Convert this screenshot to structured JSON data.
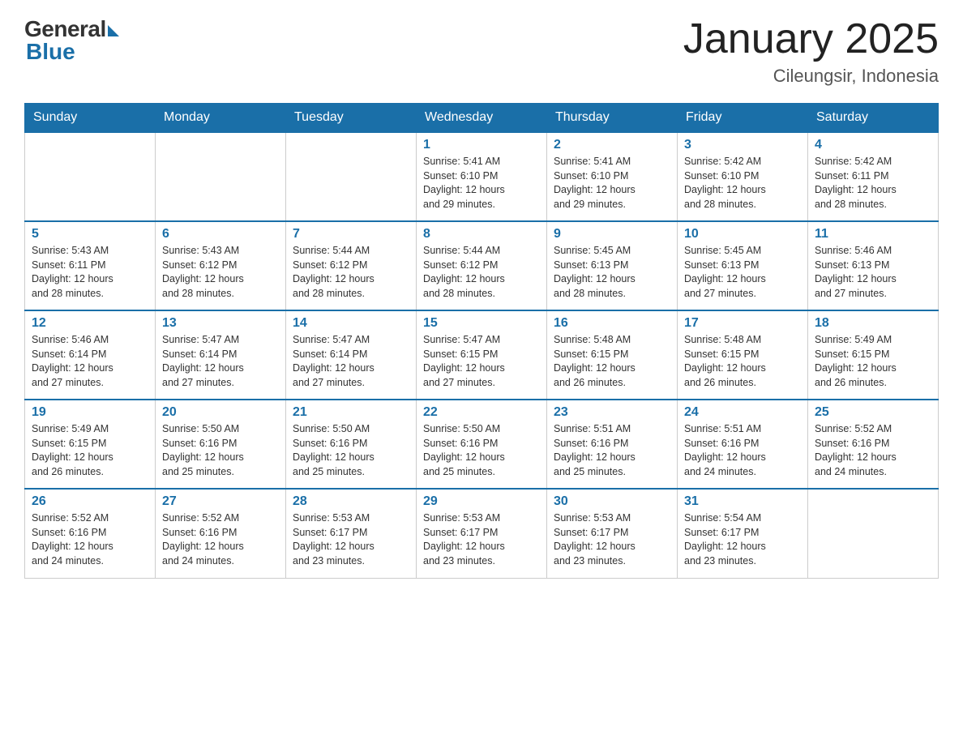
{
  "header": {
    "logo_general": "General",
    "logo_blue": "Blue",
    "month_title": "January 2025",
    "location": "Cileungsir, Indonesia"
  },
  "weekdays": [
    "Sunday",
    "Monday",
    "Tuesday",
    "Wednesday",
    "Thursday",
    "Friday",
    "Saturday"
  ],
  "weeks": [
    [
      {
        "day": "",
        "info": ""
      },
      {
        "day": "",
        "info": ""
      },
      {
        "day": "",
        "info": ""
      },
      {
        "day": "1",
        "info": "Sunrise: 5:41 AM\nSunset: 6:10 PM\nDaylight: 12 hours\nand 29 minutes."
      },
      {
        "day": "2",
        "info": "Sunrise: 5:41 AM\nSunset: 6:10 PM\nDaylight: 12 hours\nand 29 minutes."
      },
      {
        "day": "3",
        "info": "Sunrise: 5:42 AM\nSunset: 6:10 PM\nDaylight: 12 hours\nand 28 minutes."
      },
      {
        "day": "4",
        "info": "Sunrise: 5:42 AM\nSunset: 6:11 PM\nDaylight: 12 hours\nand 28 minutes."
      }
    ],
    [
      {
        "day": "5",
        "info": "Sunrise: 5:43 AM\nSunset: 6:11 PM\nDaylight: 12 hours\nand 28 minutes."
      },
      {
        "day": "6",
        "info": "Sunrise: 5:43 AM\nSunset: 6:12 PM\nDaylight: 12 hours\nand 28 minutes."
      },
      {
        "day": "7",
        "info": "Sunrise: 5:44 AM\nSunset: 6:12 PM\nDaylight: 12 hours\nand 28 minutes."
      },
      {
        "day": "8",
        "info": "Sunrise: 5:44 AM\nSunset: 6:12 PM\nDaylight: 12 hours\nand 28 minutes."
      },
      {
        "day": "9",
        "info": "Sunrise: 5:45 AM\nSunset: 6:13 PM\nDaylight: 12 hours\nand 28 minutes."
      },
      {
        "day": "10",
        "info": "Sunrise: 5:45 AM\nSunset: 6:13 PM\nDaylight: 12 hours\nand 27 minutes."
      },
      {
        "day": "11",
        "info": "Sunrise: 5:46 AM\nSunset: 6:13 PM\nDaylight: 12 hours\nand 27 minutes."
      }
    ],
    [
      {
        "day": "12",
        "info": "Sunrise: 5:46 AM\nSunset: 6:14 PM\nDaylight: 12 hours\nand 27 minutes."
      },
      {
        "day": "13",
        "info": "Sunrise: 5:47 AM\nSunset: 6:14 PM\nDaylight: 12 hours\nand 27 minutes."
      },
      {
        "day": "14",
        "info": "Sunrise: 5:47 AM\nSunset: 6:14 PM\nDaylight: 12 hours\nand 27 minutes."
      },
      {
        "day": "15",
        "info": "Sunrise: 5:47 AM\nSunset: 6:15 PM\nDaylight: 12 hours\nand 27 minutes."
      },
      {
        "day": "16",
        "info": "Sunrise: 5:48 AM\nSunset: 6:15 PM\nDaylight: 12 hours\nand 26 minutes."
      },
      {
        "day": "17",
        "info": "Sunrise: 5:48 AM\nSunset: 6:15 PM\nDaylight: 12 hours\nand 26 minutes."
      },
      {
        "day": "18",
        "info": "Sunrise: 5:49 AM\nSunset: 6:15 PM\nDaylight: 12 hours\nand 26 minutes."
      }
    ],
    [
      {
        "day": "19",
        "info": "Sunrise: 5:49 AM\nSunset: 6:15 PM\nDaylight: 12 hours\nand 26 minutes."
      },
      {
        "day": "20",
        "info": "Sunrise: 5:50 AM\nSunset: 6:16 PM\nDaylight: 12 hours\nand 25 minutes."
      },
      {
        "day": "21",
        "info": "Sunrise: 5:50 AM\nSunset: 6:16 PM\nDaylight: 12 hours\nand 25 minutes."
      },
      {
        "day": "22",
        "info": "Sunrise: 5:50 AM\nSunset: 6:16 PM\nDaylight: 12 hours\nand 25 minutes."
      },
      {
        "day": "23",
        "info": "Sunrise: 5:51 AM\nSunset: 6:16 PM\nDaylight: 12 hours\nand 25 minutes."
      },
      {
        "day": "24",
        "info": "Sunrise: 5:51 AM\nSunset: 6:16 PM\nDaylight: 12 hours\nand 24 minutes."
      },
      {
        "day": "25",
        "info": "Sunrise: 5:52 AM\nSunset: 6:16 PM\nDaylight: 12 hours\nand 24 minutes."
      }
    ],
    [
      {
        "day": "26",
        "info": "Sunrise: 5:52 AM\nSunset: 6:16 PM\nDaylight: 12 hours\nand 24 minutes."
      },
      {
        "day": "27",
        "info": "Sunrise: 5:52 AM\nSunset: 6:16 PM\nDaylight: 12 hours\nand 24 minutes."
      },
      {
        "day": "28",
        "info": "Sunrise: 5:53 AM\nSunset: 6:17 PM\nDaylight: 12 hours\nand 23 minutes."
      },
      {
        "day": "29",
        "info": "Sunrise: 5:53 AM\nSunset: 6:17 PM\nDaylight: 12 hours\nand 23 minutes."
      },
      {
        "day": "30",
        "info": "Sunrise: 5:53 AM\nSunset: 6:17 PM\nDaylight: 12 hours\nand 23 minutes."
      },
      {
        "day": "31",
        "info": "Sunrise: 5:54 AM\nSunset: 6:17 PM\nDaylight: 12 hours\nand 23 minutes."
      },
      {
        "day": "",
        "info": ""
      }
    ]
  ]
}
